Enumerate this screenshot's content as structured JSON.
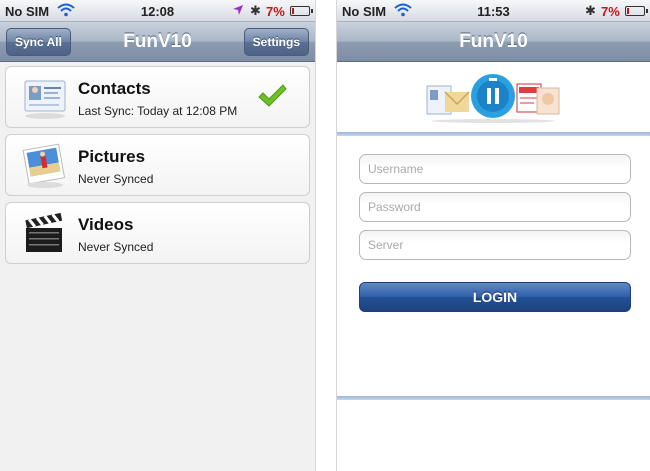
{
  "left_phone": {
    "status_bar": {
      "carrier": "No SIM",
      "time": "12:08",
      "battery": "7%"
    },
    "nav": {
      "title": "FunV10",
      "sync_all_label": "Sync All",
      "settings_label": "Settings"
    },
    "items": [
      {
        "title": "Contacts",
        "subtitle": "Last Sync: Today at 12:08 PM",
        "icon": "contact-card-icon",
        "synced": true
      },
      {
        "title": "Pictures",
        "subtitle": "Never Synced",
        "icon": "photo-icon",
        "synced": false
      },
      {
        "title": "Videos",
        "subtitle": "Never Synced",
        "icon": "clapperboard-icon",
        "synced": false
      }
    ]
  },
  "right_phone": {
    "status_bar": {
      "carrier": "No SIM",
      "time": "11:53",
      "battery": "7%"
    },
    "nav": {
      "title": "FunV10"
    },
    "login": {
      "username_placeholder": "Username",
      "password_placeholder": "Password",
      "server_placeholder": "Server",
      "login_label": "LOGIN"
    }
  },
  "colors": {
    "nav_bar": "#8d9cb1",
    "login_button": "#2f5fa8",
    "battery_low": "#c01818",
    "check_green": "#6fbf2a"
  }
}
